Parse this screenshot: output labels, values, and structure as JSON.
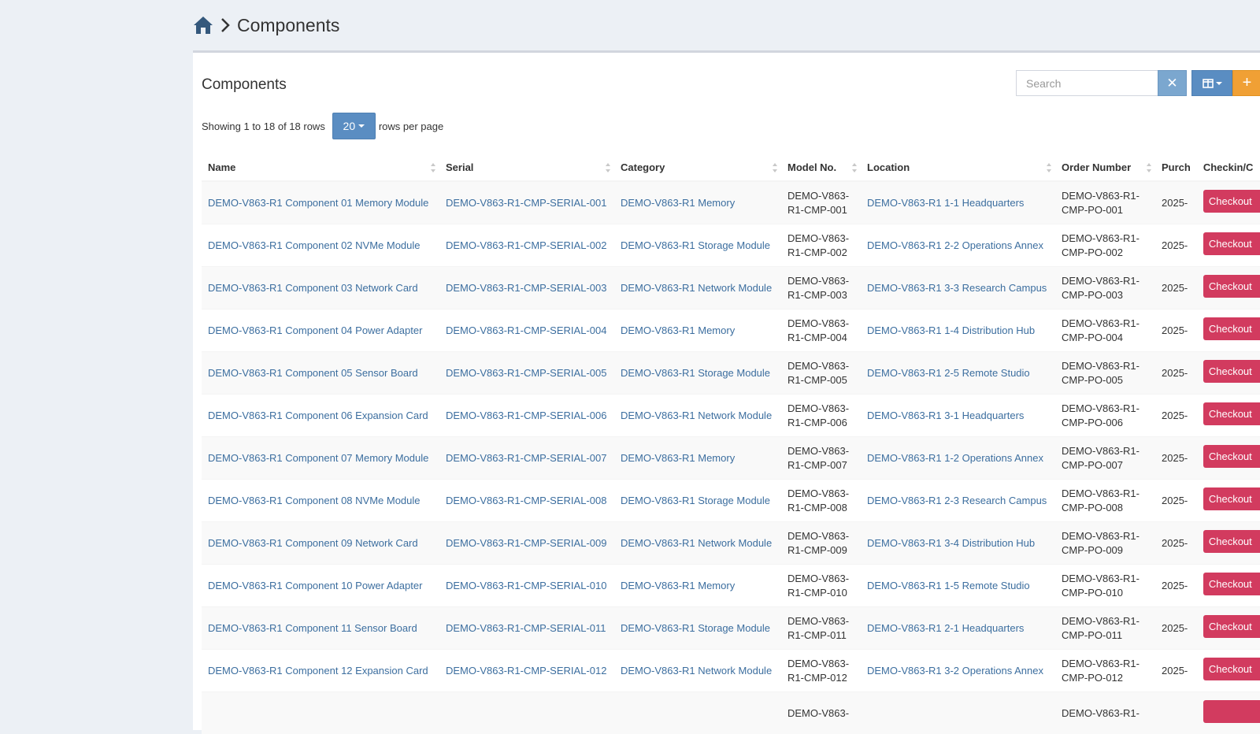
{
  "breadcrumb": {
    "title": "Components"
  },
  "box": {
    "title": "Components"
  },
  "search": {
    "placeholder": "Search",
    "clear_label": "✕",
    "add_label": "+"
  },
  "pagination": {
    "showing": "Showing 1 to 18 of 18 rows",
    "page_size": "20",
    "suffix": "rows per page"
  },
  "columns": [
    "Name",
    "Serial",
    "Category",
    "Model No.",
    "Location",
    "Order Number",
    "Purch",
    "Checkin/C"
  ],
  "rows": [
    {
      "name": "DEMO-V863-R1 Component 01 Memory Module",
      "serial": "DEMO-V863-R1-CMP-SERIAL-001",
      "category": "DEMO-V863-R1 Memory",
      "model_a": "DEMO-V863-",
      "model_b": "R1-CMP-001",
      "location": "DEMO-V863-R1 1-1 Headquarters",
      "order_a": "DEMO-V863-R1-",
      "order_b": "CMP-PO-001",
      "purchase": "2025-",
      "action": "Checkout"
    },
    {
      "name": "DEMO-V863-R1 Component 02 NVMe Module",
      "serial": "DEMO-V863-R1-CMP-SERIAL-002",
      "category": "DEMO-V863-R1 Storage Module",
      "model_a": "DEMO-V863-",
      "model_b": "R1-CMP-002",
      "location": "DEMO-V863-R1 2-2 Operations Annex",
      "order_a": "DEMO-V863-R1-",
      "order_b": "CMP-PO-002",
      "purchase": "2025-",
      "action": "Checkout"
    },
    {
      "name": "DEMO-V863-R1 Component 03 Network Card",
      "serial": "DEMO-V863-R1-CMP-SERIAL-003",
      "category": "DEMO-V863-R1 Network Module",
      "model_a": "DEMO-V863-",
      "model_b": "R1-CMP-003",
      "location": "DEMO-V863-R1 3-3 Research Campus",
      "order_a": "DEMO-V863-R1-",
      "order_b": "CMP-PO-003",
      "purchase": "2025-",
      "action": "Checkout"
    },
    {
      "name": "DEMO-V863-R1 Component 04 Power Adapter",
      "serial": "DEMO-V863-R1-CMP-SERIAL-004",
      "category": "DEMO-V863-R1 Memory",
      "model_a": "DEMO-V863-",
      "model_b": "R1-CMP-004",
      "location": "DEMO-V863-R1 1-4 Distribution Hub",
      "order_a": "DEMO-V863-R1-",
      "order_b": "CMP-PO-004",
      "purchase": "2025-",
      "action": "Checkout"
    },
    {
      "name": "DEMO-V863-R1 Component 05 Sensor Board",
      "serial": "DEMO-V863-R1-CMP-SERIAL-005",
      "category": "DEMO-V863-R1 Storage Module",
      "model_a": "DEMO-V863-",
      "model_b": "R1-CMP-005",
      "location": "DEMO-V863-R1 2-5 Remote Studio",
      "order_a": "DEMO-V863-R1-",
      "order_b": "CMP-PO-005",
      "purchase": "2025-",
      "action": "Checkout"
    },
    {
      "name": "DEMO-V863-R1 Component 06 Expansion Card",
      "serial": "DEMO-V863-R1-CMP-SERIAL-006",
      "category": "DEMO-V863-R1 Network Module",
      "model_a": "DEMO-V863-",
      "model_b": "R1-CMP-006",
      "location": "DEMO-V863-R1 3-1 Headquarters",
      "order_a": "DEMO-V863-R1-",
      "order_b": "CMP-PO-006",
      "purchase": "2025-",
      "action": "Checkout"
    },
    {
      "name": "DEMO-V863-R1 Component 07 Memory Module",
      "serial": "DEMO-V863-R1-CMP-SERIAL-007",
      "category": "DEMO-V863-R1 Memory",
      "model_a": "DEMO-V863-",
      "model_b": "R1-CMP-007",
      "location": "DEMO-V863-R1 1-2 Operations Annex",
      "order_a": "DEMO-V863-R1-",
      "order_b": "CMP-PO-007",
      "purchase": "2025-",
      "action": "Checkout"
    },
    {
      "name": "DEMO-V863-R1 Component 08 NVMe Module",
      "serial": "DEMO-V863-R1-CMP-SERIAL-008",
      "category": "DEMO-V863-R1 Storage Module",
      "model_a": "DEMO-V863-",
      "model_b": "R1-CMP-008",
      "location": "DEMO-V863-R1 2-3 Research Campus",
      "order_a": "DEMO-V863-R1-",
      "order_b": "CMP-PO-008",
      "purchase": "2025-",
      "action": "Checkout"
    },
    {
      "name": "DEMO-V863-R1 Component 09 Network Card",
      "serial": "DEMO-V863-R1-CMP-SERIAL-009",
      "category": "DEMO-V863-R1 Network Module",
      "model_a": "DEMO-V863-",
      "model_b": "R1-CMP-009",
      "location": "DEMO-V863-R1 3-4 Distribution Hub",
      "order_a": "DEMO-V863-R1-",
      "order_b": "CMP-PO-009",
      "purchase": "2025-",
      "action": "Checkout"
    },
    {
      "name": "DEMO-V863-R1 Component 10 Power Adapter",
      "serial": "DEMO-V863-R1-CMP-SERIAL-010",
      "category": "DEMO-V863-R1 Memory",
      "model_a": "DEMO-V863-",
      "model_b": "R1-CMP-010",
      "location": "DEMO-V863-R1 1-5 Remote Studio",
      "order_a": "DEMO-V863-R1-",
      "order_b": "CMP-PO-010",
      "purchase": "2025-",
      "action": "Checkout"
    },
    {
      "name": "DEMO-V863-R1 Component 11 Sensor Board",
      "serial": "DEMO-V863-R1-CMP-SERIAL-011",
      "category": "DEMO-V863-R1 Storage Module",
      "model_a": "DEMO-V863-",
      "model_b": "R1-CMP-011",
      "location": "DEMO-V863-R1 2-1 Headquarters",
      "order_a": "DEMO-V863-R1-",
      "order_b": "CMP-PO-011",
      "purchase": "2025-",
      "action": "Checkout"
    },
    {
      "name": "DEMO-V863-R1 Component 12 Expansion Card",
      "serial": "DEMO-V863-R1-CMP-SERIAL-012",
      "category": "DEMO-V863-R1 Network Module",
      "model_a": "DEMO-V863-",
      "model_b": "R1-CMP-012",
      "location": "DEMO-V863-R1 3-2 Operations Annex",
      "order_a": "DEMO-V863-R1-",
      "order_b": "CMP-PO-012",
      "purchase": "2025-",
      "action": "Checkout"
    },
    {
      "name": "",
      "serial": "",
      "category": "",
      "model_a": "DEMO-V863-",
      "model_b": "",
      "location": "",
      "order_a": "DEMO-V863-R1-",
      "order_b": "",
      "purchase": "",
      "action": ""
    }
  ],
  "colors": {
    "link": "#3c6e9f",
    "primary": "#5a8dc2",
    "warning": "#f0a035",
    "danger": "#d23b5f",
    "background": "#ecf0f5"
  }
}
